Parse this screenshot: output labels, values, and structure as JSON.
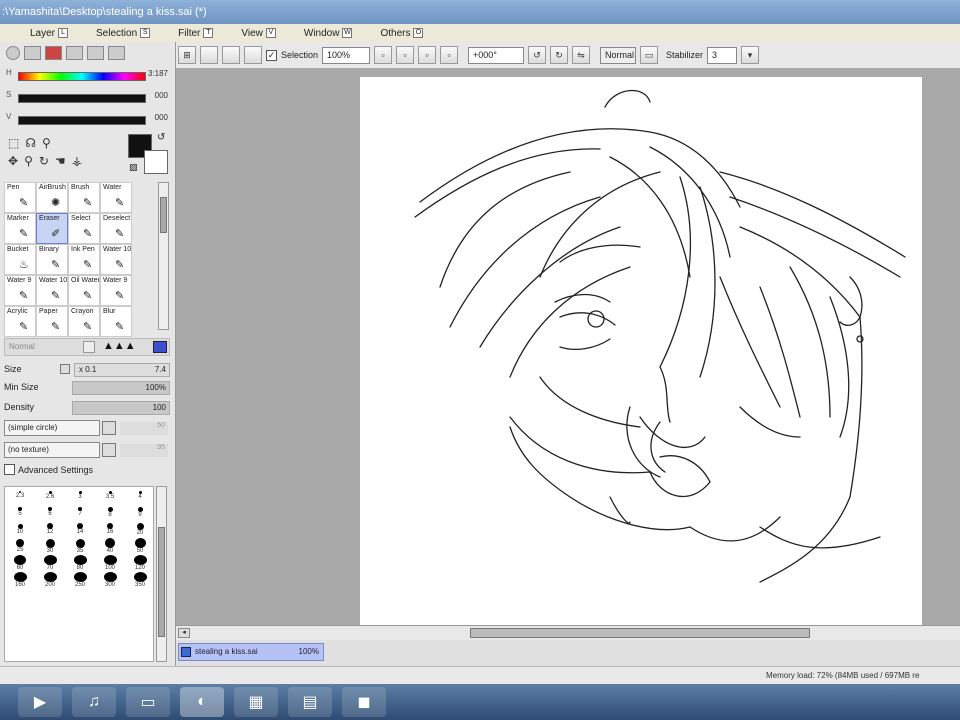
{
  "window": {
    "title": ":\\Yamashita\\Desktop\\stealing a kiss.sai (*)"
  },
  "menu": [
    {
      "label": "Layer",
      "key": "L"
    },
    {
      "label": "Selection",
      "key": "S"
    },
    {
      "label": "Filter",
      "key": "T"
    },
    {
      "label": "View",
      "key": "V"
    },
    {
      "label": "Window",
      "key": "W"
    },
    {
      "label": "Others",
      "key": "O"
    }
  ],
  "toolbar": {
    "selection_label": "Selection",
    "zoom": "100%",
    "rotation": "+000°",
    "blend_mode": "Normal",
    "stabilizer_label": "Stabilizer",
    "stabilizer_value": "3"
  },
  "color": {
    "h_label": "H",
    "h_value": "3:187",
    "s_label": "S",
    "s_value": "000",
    "v_label": "V",
    "v_value": "000",
    "primary": "#111111",
    "secondary": "#ffffff"
  },
  "tools": [
    {
      "label": "Pen",
      "glyph": "✎"
    },
    {
      "label": "AirBrush",
      "glyph": "✺"
    },
    {
      "label": "Brush",
      "glyph": "✎"
    },
    {
      "label": "Water",
      "glyph": "✎"
    },
    {
      "label": "",
      "glyph": ""
    },
    {
      "label": "Marker",
      "glyph": "✎"
    },
    {
      "label": "Eraser",
      "glyph": "✐"
    },
    {
      "label": "Select",
      "glyph": "✎"
    },
    {
      "label": "Deselect",
      "glyph": "✎"
    },
    {
      "label": "",
      "glyph": ""
    },
    {
      "label": "Bucket",
      "glyph": "♨"
    },
    {
      "label": "Binary",
      "glyph": "✎"
    },
    {
      "label": "Ink Pen",
      "glyph": "✎"
    },
    {
      "label": "Water 10",
      "glyph": "✎"
    },
    {
      "label": "",
      "glyph": ""
    },
    {
      "label": "Water 9",
      "glyph": "✎"
    },
    {
      "label": "Water 10",
      "glyph": "✎"
    },
    {
      "label": "Oil Water",
      "glyph": "✎"
    },
    {
      "label": "Water 9",
      "glyph": "✎"
    },
    {
      "label": "",
      "glyph": ""
    },
    {
      "label": "Acrylic",
      "glyph": "✎"
    },
    {
      "label": "Paper",
      "glyph": "✎"
    },
    {
      "label": "Crayon",
      "glyph": "✎"
    },
    {
      "label": "Blur",
      "glyph": "✎"
    },
    {
      "label": "",
      "glyph": ""
    }
  ],
  "brush": {
    "mode": "Normal",
    "size_label": "Size",
    "size_mult": "x 0.1",
    "size_value": "7.4",
    "minsize_label": "Min Size",
    "minsize_value": "100%",
    "density_label": "Density",
    "density_value": "100",
    "shape": "(simple circle)",
    "shape_value": "50",
    "texture": "(no texture)",
    "texture_value": "95",
    "advanced": "Advanced Settings"
  },
  "sizes": [
    "2.3",
    "2.6",
    "3",
    "3.5",
    "4",
    "5",
    "6",
    "7",
    "8",
    "9",
    "10",
    "12",
    "14",
    "16",
    "20",
    "25",
    "30",
    "35",
    "40",
    "50",
    "60",
    "70",
    "80",
    "100",
    "120",
    "160",
    "200",
    "250",
    "300",
    "350"
  ],
  "document": {
    "tab_name": "stealing a kiss.sai",
    "zoom": "100%"
  },
  "status": {
    "memory": "Memory load: 72% (84MB used / 697MB re"
  },
  "taskbar": [
    {
      "name": "media-player",
      "glyph": "▶"
    },
    {
      "name": "itunes",
      "glyph": "♫"
    },
    {
      "name": "monitor",
      "glyph": "▭"
    },
    {
      "name": "paint-tool-sai",
      "glyph": "◐"
    },
    {
      "name": "photo-viewer",
      "glyph": "▦"
    },
    {
      "name": "notes",
      "glyph": "▤"
    },
    {
      "name": "camera",
      "glyph": "◼"
    }
  ]
}
